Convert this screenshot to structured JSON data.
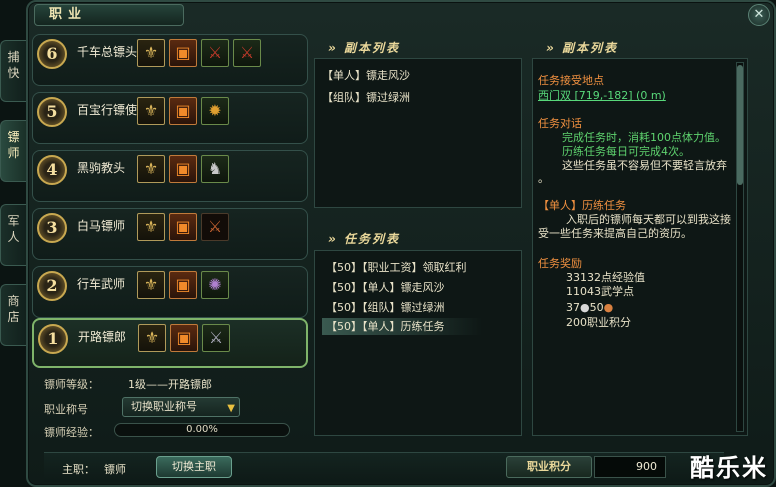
{
  "window": {
    "title": "职业"
  },
  "side_tabs": [
    "捕快",
    "镖师",
    "军人",
    "商店"
  ],
  "classes": [
    {
      "rank": "6",
      "name": "千车总镖头"
    },
    {
      "rank": "5",
      "name": "百宝行镖使"
    },
    {
      "rank": "4",
      "name": "黑驹教头"
    },
    {
      "rank": "3",
      "name": "白马镖师"
    },
    {
      "rank": "2",
      "name": "行车武师"
    },
    {
      "rank": "1",
      "name": "开路镖郎"
    }
  ],
  "info": {
    "level_label": "镖师等级：",
    "level_value": "1级——开路镖郎",
    "title_label": "职业称号",
    "title_dropdown": "切换职业称号",
    "exp_label": "镖师经验：",
    "exp_value": "0.00%"
  },
  "dungeon_list": {
    "title": "» 副本列表",
    "items": [
      "【单人】镖走风沙",
      "【组队】镖过绿洲"
    ]
  },
  "task_list": {
    "title": "» 任务列表",
    "items": [
      "【50】【职业工资】领取红利",
      "【50】【单人】镖走风沙",
      "【50】【组队】镖过绿洲",
      "【50】【单人】历练任务"
    ]
  },
  "detail": {
    "title": "» 副本列表",
    "accept_label": "任务接受地点",
    "accept_place": "西门双 [719,-182] (0 m)",
    "dialog_label": "任务对话",
    "dialog_line1": "完成任务时，消耗100点体力值。",
    "dialog_line2": "历练任务每日可完成4次。",
    "dialog_line3": "这些任务虽不容易但不要轻言放弃",
    "dialog_line4": "。",
    "task_name": "【单人】历练任务",
    "task_desc1": "入职后的镖师每天都可以到我这接",
    "task_desc2": "受一些任务来提高自己的资历。",
    "reward_label": "任务奖励",
    "reward_exp": "33132点经验值",
    "reward_wuxue": "11043武学点",
    "reward_money_a": "37",
    "reward_money_b": "50",
    "reward_points": "200职业积分"
  },
  "bottom": {
    "main_label": "主职：",
    "main_value": "镖师",
    "switch_button": "切换主职",
    "points_label": "职业积分",
    "points_value": "900"
  },
  "watermark": "酷乐米"
}
